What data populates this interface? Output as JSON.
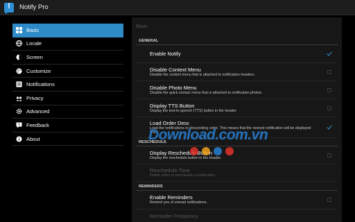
{
  "app": {
    "title": "Notify Pro"
  },
  "sidebar": {
    "items": [
      {
        "label": "Basic",
        "icon": "grid-icon",
        "active": true
      },
      {
        "label": "Locale",
        "icon": "globe-icon"
      },
      {
        "label": "Screen",
        "icon": "screen-icon"
      },
      {
        "label": "Customize",
        "icon": "palette-icon"
      },
      {
        "label": "Notifications",
        "icon": "notification-icon"
      },
      {
        "label": "Privacy",
        "icon": "privacy-icon"
      },
      {
        "label": "Advanced",
        "icon": "settings-icon"
      },
      {
        "label": "Feedback",
        "icon": "feedback-icon"
      },
      {
        "label": "About",
        "icon": "info-icon"
      }
    ]
  },
  "panel": {
    "header": "Basic",
    "sections": {
      "general": "GENERAL",
      "reschedule": "RESCHEDULE",
      "reminders": "REMINDERS"
    },
    "prefs": {
      "enable_notify": {
        "title": "Enable Notify",
        "checked": true
      },
      "disable_context_menu": {
        "title": "Disable Context Menu",
        "summary": "Disable the context menu that is attached to notification headers.",
        "checked": false
      },
      "disable_photo_menu": {
        "title": "Disable Photo Menu",
        "summary": "Disable the quick contact menu that is attached to notification photos.",
        "checked": false
      },
      "display_tts_button": {
        "title": "Display TTS Button",
        "summary": "Display the text-to-speech (TTS) button in the header.",
        "checked": false
      },
      "load_order_desc": {
        "title": "Load Order Desc",
        "summary": "Load the notifications in descending order. This means that the newest notification will be displayed first.",
        "checked": true
      },
      "display_reschedule_button": {
        "title": "Display Reschedule Button",
        "summary": "Display the reschedule button in the header.",
        "checked": false
      },
      "reschedule_time": {
        "title": "Reschedule Time",
        "summary": "Define when to reschedule a notification.",
        "enabled": false
      },
      "enable_reminders": {
        "title": "Enable Reminders",
        "summary": "Remind you of unread notifications.",
        "checked": false
      },
      "reminder_frequency": {
        "title": "Reminder Frequency",
        "enabled": false
      }
    }
  },
  "watermark": {
    "text": "Download.com.vn",
    "dot_colors": [
      "#e2332b",
      "#f0a21e",
      "#2a7fd0",
      "#e2332b"
    ]
  },
  "colors": {
    "accent": "#2e8bc8",
    "check": "#3a9ad9"
  }
}
